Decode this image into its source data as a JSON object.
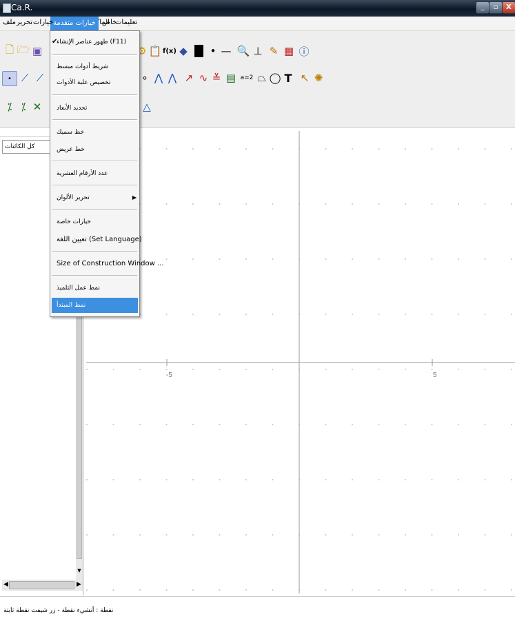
{
  "window": {
    "title": "Ca.R.",
    "controls": {
      "minimize": "_",
      "maximize": "▫",
      "close": "X"
    }
  },
  "menubar": {
    "items": [
      {
        "key": "tools",
        "label": "تعليمات"
      },
      {
        "key": "special",
        "label": "خاص"
      },
      {
        "key": "macros",
        "label": "الماكروات"
      },
      {
        "key": "advanced",
        "label": "خيارات متقدمة"
      },
      {
        "key": "options",
        "label": "خيارات"
      },
      {
        "key": "edit",
        "label": "تحرير"
      },
      {
        "key": "file",
        "label": "ملف"
      }
    ]
  },
  "dropdown": {
    "items": [
      {
        "label": "طهور عناصر الإنشاء  (F11)",
        "checked": true,
        "check_mark": "✔"
      },
      {
        "label": "شريط أدوات مبسط"
      },
      {
        "label": "تخصيص علبة الأدوات"
      },
      {
        "label": "تحديد الأبعاد"
      },
      {
        "label": "خط سميك"
      },
      {
        "label": "خط عريض"
      },
      {
        "label": "عدد الأرقام العشرية"
      },
      {
        "label": "تحرير الألوان",
        "submenu_arrow": "▶"
      },
      {
        "label": "خيارات خاصة"
      },
      {
        "label": "تعيين اللغة (Set Language)"
      },
      {
        "label": "Size of Construction Window ..."
      },
      {
        "label": "نمط عمل التلميذ"
      },
      {
        "label": "نمط المبتدأ",
        "highlighted": true
      }
    ]
  },
  "toolbar": {
    "row1": [
      "file-new",
      "folder-open",
      "save",
      "blank",
      "blank",
      "blank",
      "blank",
      "blank",
      "blank",
      "blank",
      "clipboard",
      "flip",
      "fill-black",
      "point-small",
      "line-dash",
      "magnifier",
      "perpendicular-axis",
      "pencil-mark",
      "color-grid",
      "info"
    ],
    "text_fx": "f(x)",
    "text_T": "T",
    "text_ratio": "a=2"
  },
  "left_panel": {
    "combo_value": "كل الكائنات",
    "scroll_down_arrow": "▼",
    "scroll_left_arrow": "◀",
    "scroll_right_arrow": "▶"
  },
  "canvas": {
    "x_axis_labels": [
      "-5",
      "5"
    ]
  },
  "status": {
    "text": "نقطة : أنشيء نقطة - زر شيفت نقطة ثابتة"
  },
  "colors": {
    "menu_highlight": "#3d8fe0",
    "titlebar": "#0c1726",
    "axis": "#9a9a9a",
    "grid_dot": "#c4c4c4"
  }
}
